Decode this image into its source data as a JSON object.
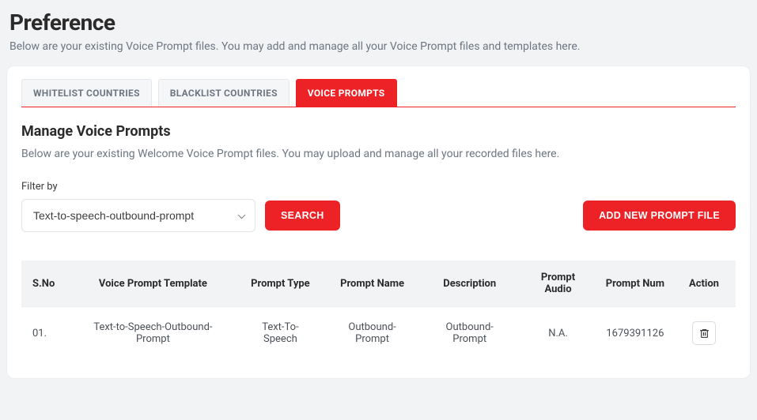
{
  "page": {
    "title": "Preference",
    "subtitle": "Below are your existing Voice Prompt files. You may add and manage all your Voice Prompt files and templates here."
  },
  "tabs": {
    "whitelist": "WHITELIST COUNTRIES",
    "blacklist": "BLACKLIST COUNTRIES",
    "voice": "VOICE PROMPTS"
  },
  "section": {
    "title": "Manage Voice Prompts",
    "subtitle": "Below are your existing Welcome Voice Prompt files. You may upload and manage all your recorded files here."
  },
  "filter": {
    "label": "Filter by",
    "selected": "Text-to-speech-outbound-prompt",
    "search_label": "SEARCH"
  },
  "buttons": {
    "add_file": "ADD NEW PROMPT FILE"
  },
  "table": {
    "headers": {
      "sno": "S.No",
      "template": "Voice Prompt Template",
      "type": "Prompt Type",
      "name": "Prompt Name",
      "desc": "Description",
      "audio": "Prompt Audio",
      "num": "Prompt Num",
      "action": "Action"
    },
    "rows": [
      {
        "sno": "01.",
        "template": "Text-to-Speech-Outbound-Prompt",
        "type": "Text-To-Speech",
        "name": "Outbound-Prompt",
        "desc": "Outbound-Prompt",
        "audio": "N.A.",
        "num": "1679391126"
      }
    ]
  }
}
